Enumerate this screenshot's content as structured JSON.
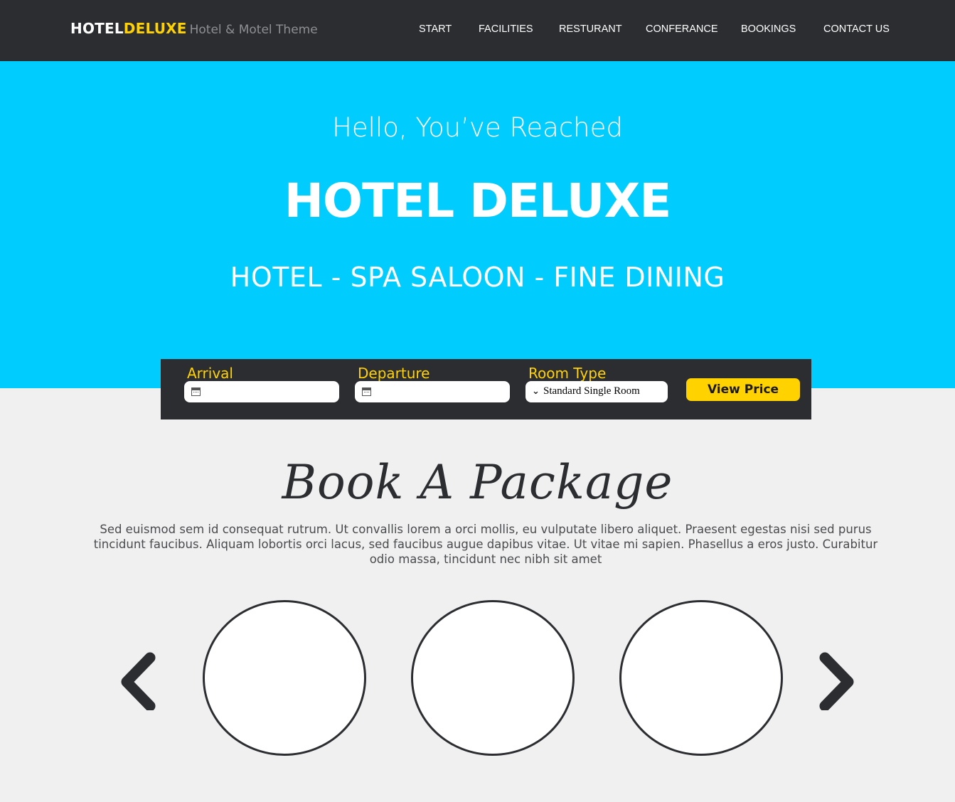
{
  "header": {
    "logo_part1": "HOTEL",
    "logo_part2": "DELUXE",
    "tagline": "Hotel & Motel Theme",
    "nav": [
      "START",
      "FACILITIES",
      "RESTURANT",
      "CONFERANCE",
      "BOOKINGS",
      "CONTACT US"
    ]
  },
  "hero": {
    "greeting": "Hello, You’ve Reached",
    "title": "HOTEL DELUXE",
    "subtitle": "HOTEL - SPA SALOON - FINE DINING"
  },
  "booking": {
    "arrival_label": "Arrival",
    "arrival_value": "",
    "departure_label": "Departure",
    "departure_value": "",
    "room_type_label": "Room Type",
    "room_type_value": "Standard Single Room",
    "view_price_label": "View Price"
  },
  "packages": {
    "title": "Book A Package",
    "description": "Sed euismod sem id consequat rutrum. Ut convallis lorem a orci mollis, eu vulputate libero aliquet. Praesent egestas nisi sed purus tincidunt faucibus. Aliquam lobortis orci lacus, sed faucibus augue dapibus vitae. Ut vitae mi sapien. Phasellus a eros justo. Curabitur odio massa, tincidunt nec nibh sit amet",
    "item_count_visible": 3
  },
  "colors": {
    "header_bg": "#2b2d31",
    "hero_bg": "#00cdfe",
    "accent": "#ffd200",
    "page_bg": "#f0f0f0"
  },
  "icons": [
    "calendar-icon",
    "chevron-down-icon",
    "chevron-left-icon",
    "chevron-right-icon"
  ]
}
